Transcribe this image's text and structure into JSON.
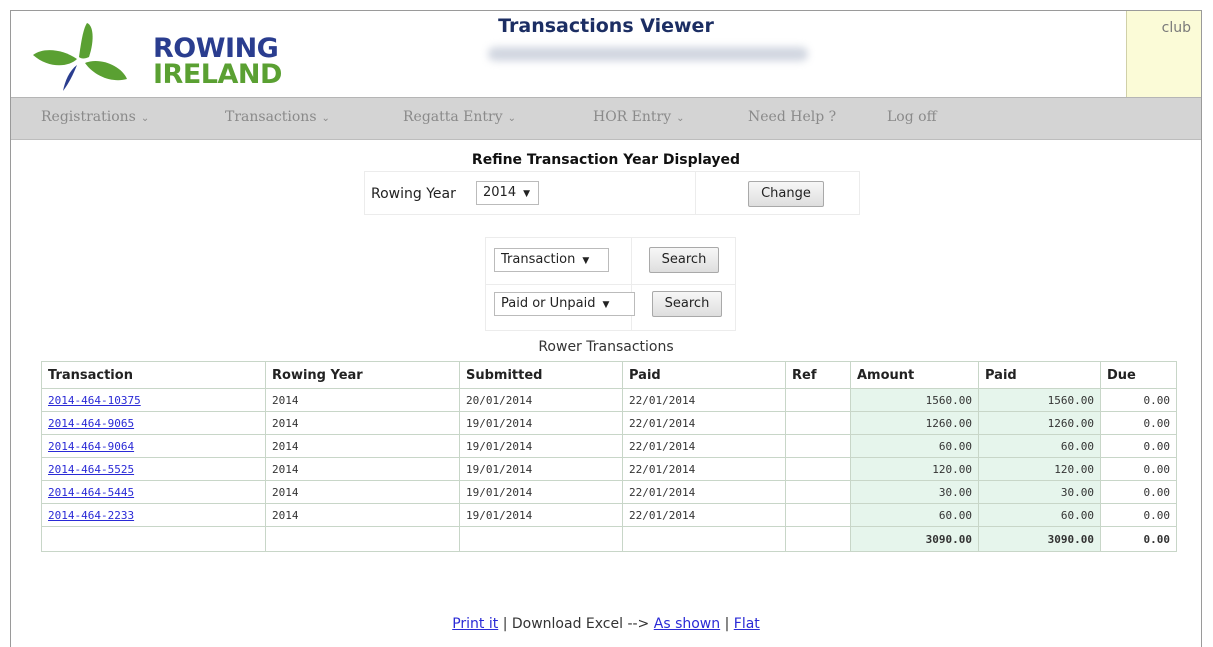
{
  "brand": {
    "line1": "ROWING",
    "line2": "IRELAND"
  },
  "header": {
    "title": "Transactions Viewer",
    "club_label": "club"
  },
  "menu": [
    {
      "label": "Registrations",
      "has_dropdown": true
    },
    {
      "label": "Transactions",
      "has_dropdown": true
    },
    {
      "label": "Regatta Entry",
      "has_dropdown": true
    },
    {
      "label": "HOR Entry",
      "has_dropdown": true
    },
    {
      "label": "Need Help ?",
      "has_dropdown": false
    },
    {
      "label": "Log off",
      "has_dropdown": false
    }
  ],
  "refine": {
    "title": "Refine Transaction Year Displayed",
    "year_label": "Rowing Year",
    "year_value": "2014",
    "change_label": "Change"
  },
  "search": {
    "filter1_value": "Transaction",
    "filter2_value": "Paid or Unpaid",
    "search_label": "Search"
  },
  "table": {
    "caption": "Rower Transactions",
    "headers": [
      "Transaction",
      "Rowing Year",
      "Submitted",
      "Paid",
      "Ref",
      "Amount",
      "Paid",
      "Due"
    ],
    "rows": [
      {
        "transaction": "2014-464-10375",
        "year": "2014",
        "submitted": "20/01/2014",
        "paid_date": "22/01/2014",
        "ref": "",
        "amount": "1560.00",
        "paid": "1560.00",
        "due": "0.00"
      },
      {
        "transaction": "2014-464-9065",
        "year": "2014",
        "submitted": "19/01/2014",
        "paid_date": "22/01/2014",
        "ref": "",
        "amount": "1260.00",
        "paid": "1260.00",
        "due": "0.00"
      },
      {
        "transaction": "2014-464-9064",
        "year": "2014",
        "submitted": "19/01/2014",
        "paid_date": "22/01/2014",
        "ref": "",
        "amount": "60.00",
        "paid": "60.00",
        "due": "0.00"
      },
      {
        "transaction": "2014-464-5525",
        "year": "2014",
        "submitted": "19/01/2014",
        "paid_date": "22/01/2014",
        "ref": "",
        "amount": "120.00",
        "paid": "120.00",
        "due": "0.00"
      },
      {
        "transaction": "2014-464-5445",
        "year": "2014",
        "submitted": "19/01/2014",
        "paid_date": "22/01/2014",
        "ref": "",
        "amount": "30.00",
        "paid": "30.00",
        "due": "0.00"
      },
      {
        "transaction": "2014-464-2233",
        "year": "2014",
        "submitted": "19/01/2014",
        "paid_date": "22/01/2014",
        "ref": "",
        "amount": "60.00",
        "paid": "60.00",
        "due": "0.00"
      }
    ],
    "totals": {
      "amount": "3090.00",
      "paid": "3090.00",
      "due": "0.00"
    }
  },
  "footer": {
    "print_label": "Print it",
    "sep1": " | ",
    "download_label": "Download Excel -->",
    "as_shown_label": "As shown",
    "sep2": " | ",
    "flat_label": "Flat"
  },
  "colors": {
    "logo_blue": "#2a3d8f",
    "logo_green": "#5aa032",
    "link": "#2a2ad6",
    "money_cell_bg": "#e6f5ec",
    "club_box_bg": "#fbfbd7"
  }
}
